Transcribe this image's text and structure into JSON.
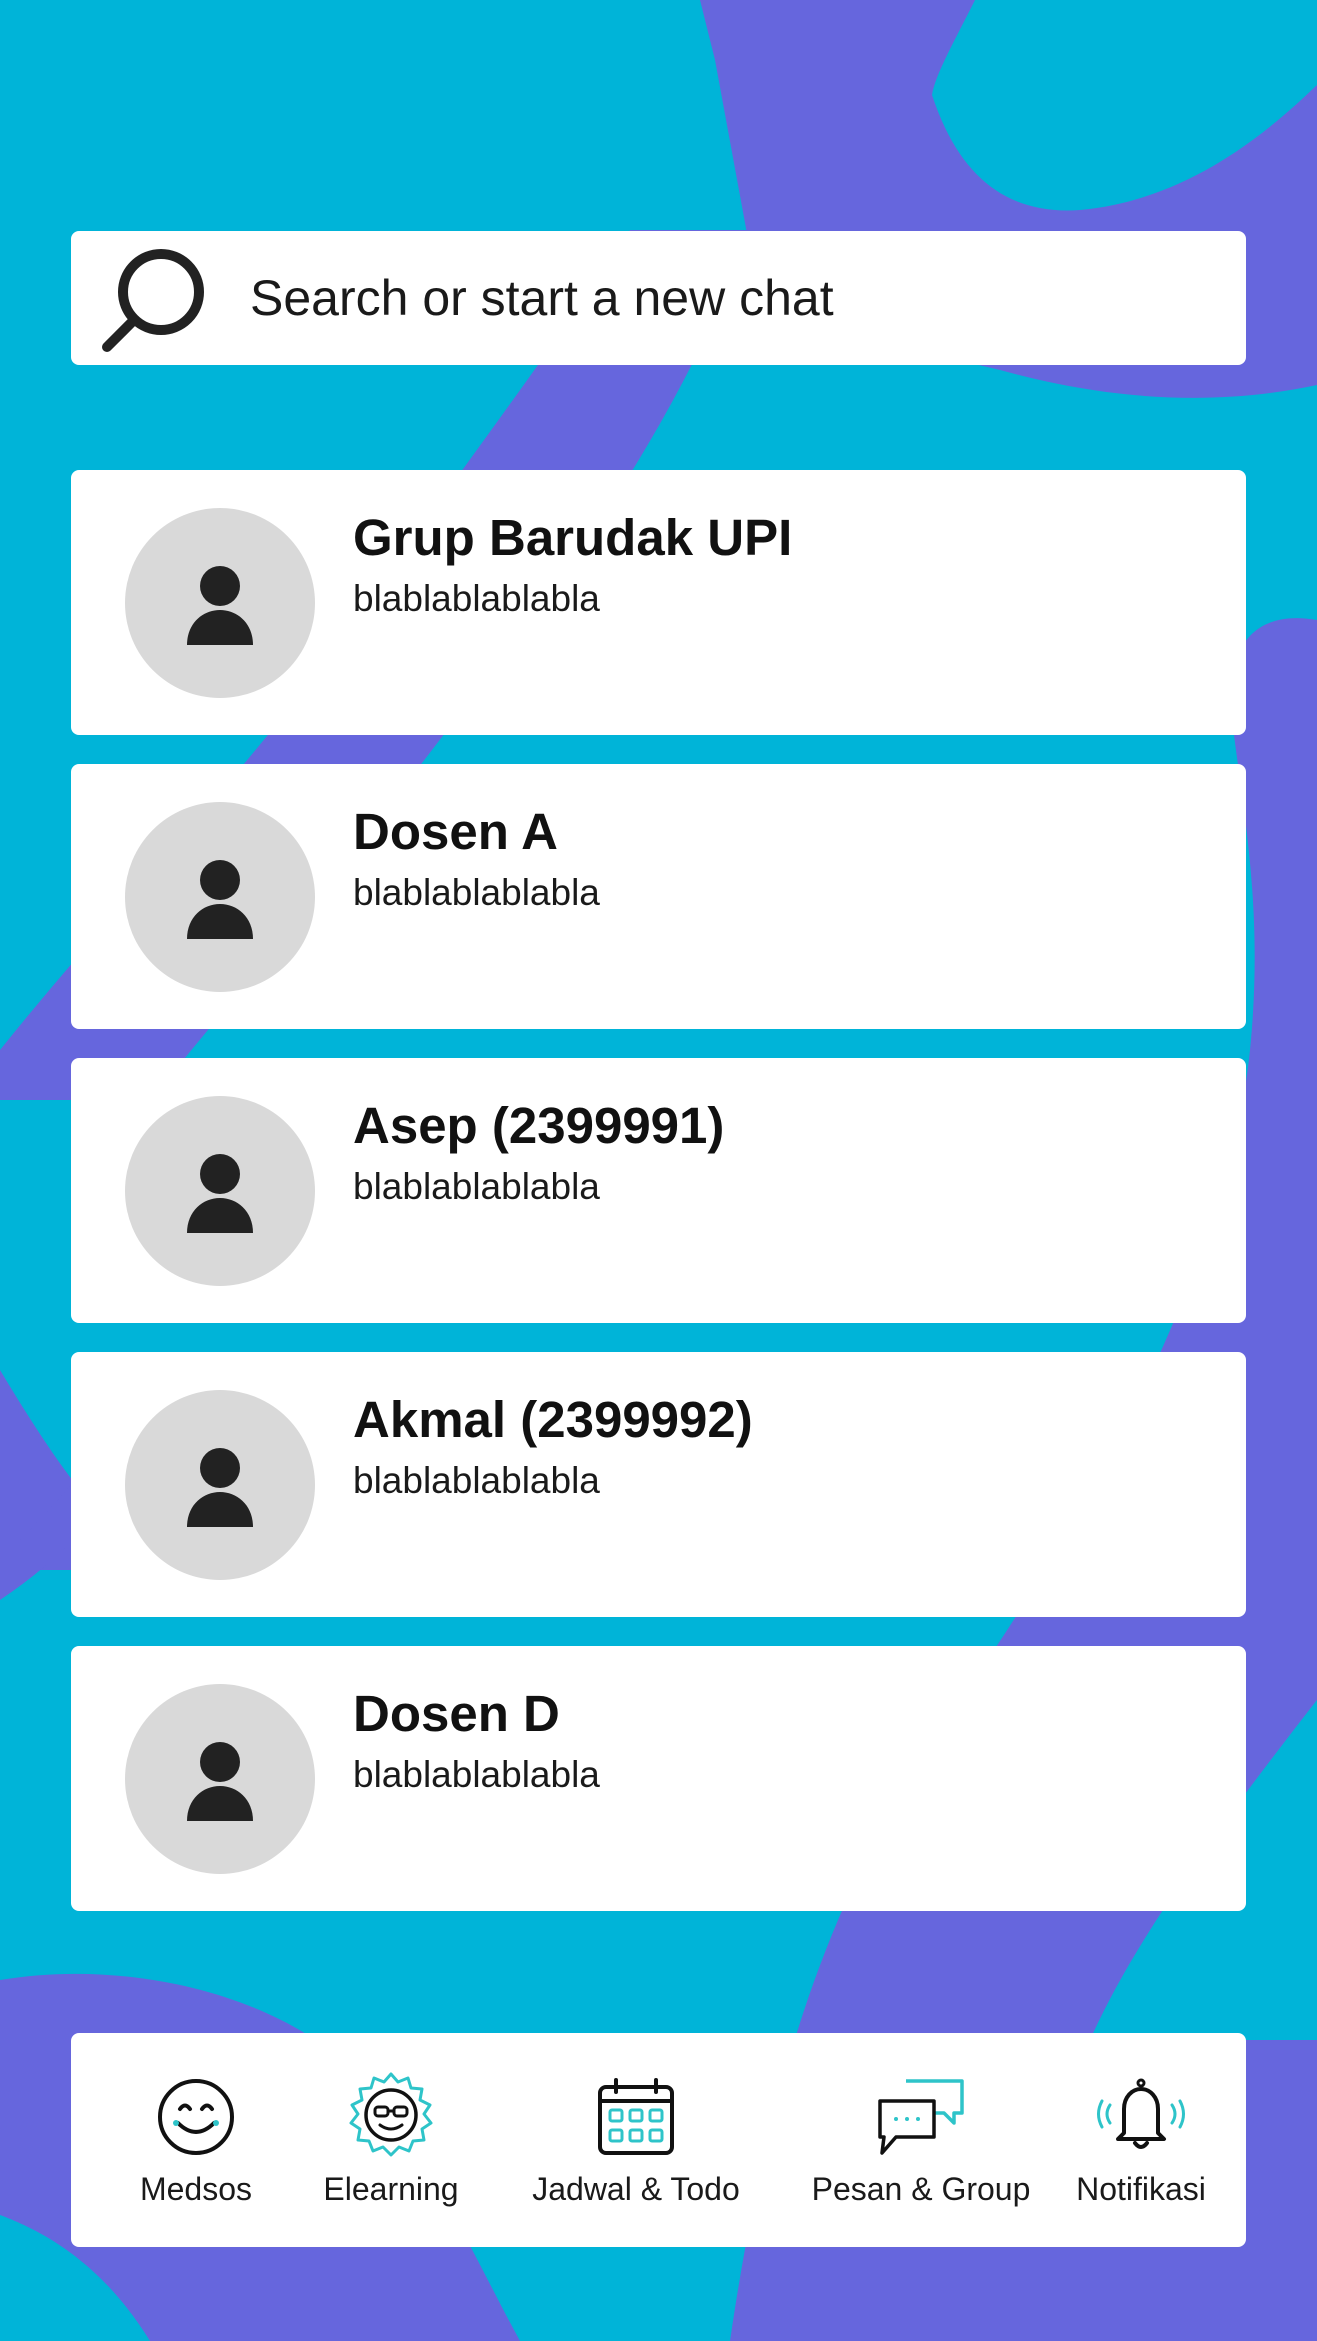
{
  "search": {
    "placeholder": "Search or start a new chat"
  },
  "chats": [
    {
      "name": "Grup Barudak UPI",
      "preview": "blablablablabla"
    },
    {
      "name": "Dosen A",
      "preview": "blablablablabla"
    },
    {
      "name": "Asep (2399991)",
      "preview": "blablablablabla"
    },
    {
      "name": "Akmal (2399992)",
      "preview": "blablablablabla"
    },
    {
      "name": "Dosen D",
      "preview": "blablablablabla"
    }
  ],
  "nav": [
    {
      "label": "Medsos",
      "icon": "smiley-face-icon"
    },
    {
      "label": "Elearning",
      "icon": "student-face-icon"
    },
    {
      "label": "Jadwal & Todo",
      "icon": "calendar-icon"
    },
    {
      "label": "Pesan & Group",
      "icon": "chat-bubbles-icon"
    },
    {
      "label": "Notifikasi",
      "icon": "bell-icon"
    }
  ],
  "colors": {
    "background": "#00b4d8",
    "blob": "#6666dd",
    "accent": "#2ec4c9",
    "avatar_bg": "#d9d9d9"
  }
}
